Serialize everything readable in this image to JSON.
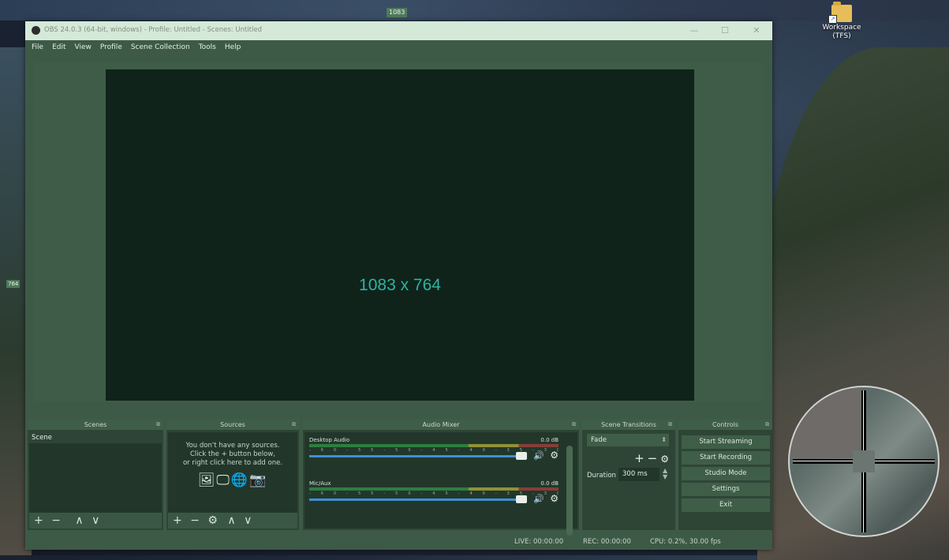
{
  "desktop": {
    "top_marker": "1083",
    "side_marker": "764",
    "icon_label": "Workspace (TFS)"
  },
  "window": {
    "title": "OBS 24.0.3 (64-bit, windows) - Profile: Untitled - Scenes: Untitled",
    "controls": {
      "minimize": "—",
      "maximize": "☐",
      "close": "✕"
    }
  },
  "menu": [
    "File",
    "Edit",
    "View",
    "Profile",
    "Scene Collection",
    "Tools",
    "Help"
  ],
  "preview": {
    "label": "1083 x 764"
  },
  "docks": {
    "scenes": {
      "title": "Scenes",
      "items": [
        "Scene"
      ],
      "footer": [
        "+",
        "−",
        "∧",
        "∨"
      ]
    },
    "sources": {
      "title": "Sources",
      "empty_msg_1": "You don't have any sources.",
      "empty_msg_2": "Click the + button below,",
      "empty_msg_3": "or right click here to add one.",
      "footer": [
        "+",
        "−",
        "⚙",
        "∧",
        "∨"
      ]
    },
    "mixer": {
      "title": "Audio Mixer",
      "channels": [
        {
          "name": "Desktop Audio",
          "db": "0.0 dB"
        },
        {
          "name": "Mic/Aux",
          "db": "0.0 dB"
        }
      ]
    },
    "transitions": {
      "title": "Scene Transitions",
      "selected": "Fade",
      "duration_label": "Duration",
      "duration_value": "300 ms"
    },
    "controls": {
      "title": "Controls",
      "buttons": [
        "Start Streaming",
        "Start Recording",
        "Studio Mode",
        "Settings",
        "Exit"
      ]
    }
  },
  "status": {
    "live": "LIVE: 00:00:00",
    "rec": "REC: 00:00:00",
    "cpu": "CPU: 0.2%, 30.00 fps"
  },
  "colors": {
    "window_bg": "#3d5a46",
    "preview_bg": "#0f231a",
    "preview_text": "#2fb2a5",
    "titlebar_bg": "#d5e9d8"
  }
}
